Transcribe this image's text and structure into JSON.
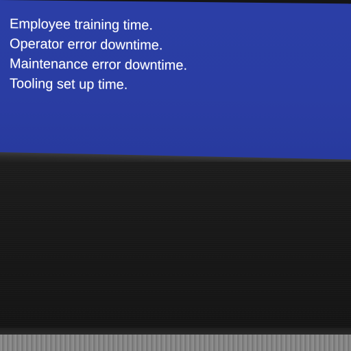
{
  "screen": {
    "background_color": "#2b3ea6",
    "lines": [
      "Employee training time.",
      "Operator error downtime.",
      "Maintenance error downtime.",
      "Tooling set up time."
    ]
  },
  "frame": {
    "bezel_color": "#171717"
  }
}
